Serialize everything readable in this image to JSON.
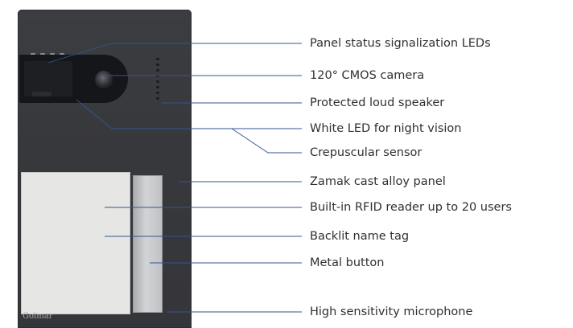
{
  "diagram": {
    "device": "video door entry panel",
    "brand_text": "Golmar",
    "labels": {
      "status_leds": "Panel status signalization LEDs",
      "camera": "120° CMOS camera",
      "speaker": "Protected loud speaker",
      "night_led": "White LED for night vision",
      "crepuscular": "Crepuscular sensor",
      "panel": "Zamak cast alloy panel",
      "rfid": "Built-in RFID reader up to 20 users",
      "name_tag": "Backlit name tag",
      "button": "Metal button",
      "microphone": "High sensitivity microphone"
    },
    "colors": {
      "panel": "#38393d",
      "leader_line": "#32568f",
      "label_text": "#2f2f35",
      "name_tag": "#e6e6e4",
      "button": "#c3c4c7"
    }
  }
}
